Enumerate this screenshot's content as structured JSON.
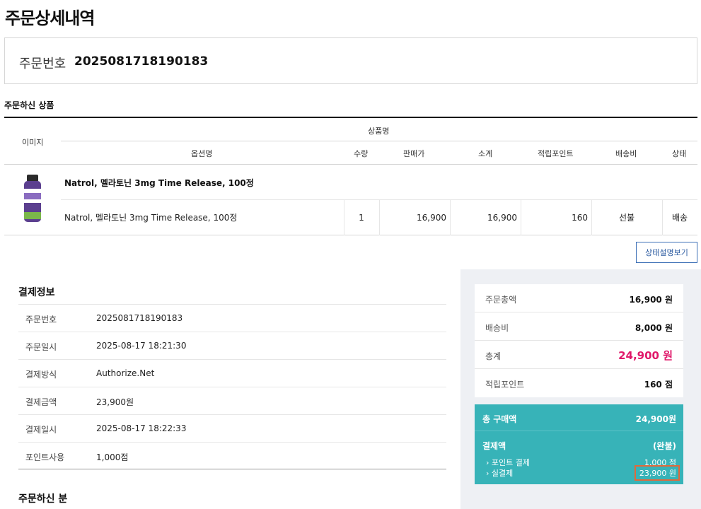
{
  "page": {
    "title": "주문상세내역"
  },
  "order": {
    "label": "주문번호",
    "number": "2025081718190183"
  },
  "products_section": {
    "label": "주문하신 상품"
  },
  "table": {
    "headers": {
      "image": "이미지",
      "product_name": "상품명",
      "option_name": "옵션명",
      "qty": "수량",
      "price": "판매가",
      "subtotal": "소계",
      "points": "적립포인트",
      "shipping": "배송비",
      "status": "상태"
    },
    "item": {
      "image_icon": "melatonin-bottle-icon",
      "name": "Natrol, 멜라토닌 3mg Time Release, 100정",
      "option": "Natrol, 멜라토닌 3mg Time Release, 100정",
      "qty": "1",
      "price": "16,900",
      "subtotal": "16,900",
      "points": "160",
      "shipping": "선불",
      "status": "배송"
    }
  },
  "status_button": {
    "label": "상태설명보기"
  },
  "payment_info": {
    "title": "결제정보",
    "rows": [
      {
        "k": "주문번호",
        "v": "2025081718190183"
      },
      {
        "k": "주문일시",
        "v": "2025-08-17 18:21:30"
      },
      {
        "k": "결제방식",
        "v": "Authorize.Net"
      },
      {
        "k": "결제금액",
        "v": "23,900원"
      },
      {
        "k": "결제일시",
        "v": "2025-08-17 18:22:33"
      },
      {
        "k": "포인트사용",
        "v": "1,000점"
      }
    ],
    "orderer_title": "주문하신 분"
  },
  "summary": {
    "order_total": {
      "k": "주문총액",
      "v": "16,900 원"
    },
    "shipping": {
      "k": "배송비",
      "v": "8,000 원"
    },
    "total": {
      "k": "총계",
      "v": "24,900 원"
    },
    "points": {
      "k": "적립포인트",
      "v": "160 점"
    }
  },
  "purchase": {
    "total_label": "총 구매액",
    "total_value": "24,900원",
    "payment_label": "결제액",
    "payment_value": "(완불)",
    "point_pay_label": "› 포인트 결제",
    "point_pay_value": "1,000 점",
    "actual_pay_label": "› 실결제",
    "actual_pay_value": "23,900 원"
  },
  "colors": {
    "teal": "#37b3b8",
    "pink": "#e0186a",
    "highlight": "#e2693a",
    "button_blue": "#3b6fb6"
  }
}
